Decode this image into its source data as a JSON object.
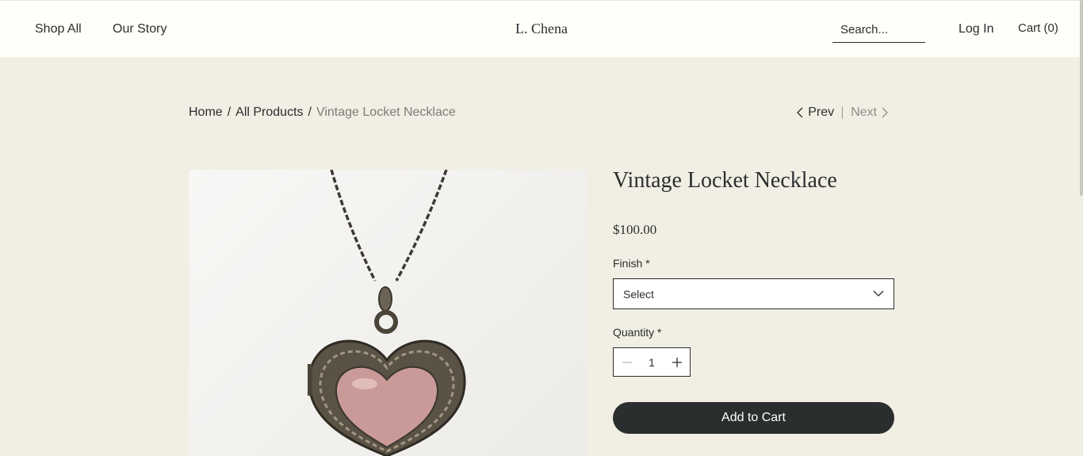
{
  "header": {
    "nav": [
      "Shop All",
      "Our Story"
    ],
    "brand": "L. Chena",
    "search_placeholder": "Search...",
    "login": "Log In",
    "cart": "Cart (0)"
  },
  "breadcrumb": {
    "home": "Home",
    "sep": "/",
    "all_products": "All Products",
    "current": "Vintage Locket Necklace"
  },
  "pager": {
    "prev": "Prev",
    "next": "Next"
  },
  "product": {
    "title": "Vintage Locket Necklace",
    "price": "$100.00",
    "finish_label": "Finish *",
    "finish_value": "Select",
    "quantity_label": "Quantity *",
    "quantity_value": "1",
    "add_to_cart": "Add to Cart"
  },
  "colors": {
    "page_bg": "#f1efe4",
    "header_bg": "#fffef9",
    "text": "#2b2e2e",
    "button_bg": "#2b2e2e"
  },
  "icons": [
    "chevron-left-icon",
    "chevron-right-icon",
    "chevron-down-icon",
    "minus-icon",
    "plus-icon"
  ]
}
